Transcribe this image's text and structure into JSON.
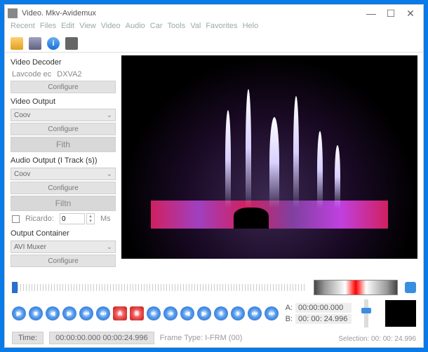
{
  "title": "Video. Mkv-Avidemux",
  "menu": [
    "Recent",
    "Files",
    "Edit",
    "View",
    "Video",
    "Audio",
    "Car",
    "Tools",
    "Val",
    "Favorites",
    "Helo"
  ],
  "side": {
    "decoder_label": "Video Decoder",
    "lavcodec": "Lavcode ec",
    "dxva": "DXVA2",
    "configure": "Configure",
    "video_output": "Video Output",
    "copy": "Coov",
    "filth": "Fith",
    "audio_output": "Audio Output (I Track (s))",
    "filtn": "Filtn",
    "ricardo": "Ricardo:",
    "ricardo_val": "0",
    "ms": "Ms",
    "container": "Output Container",
    "avi": "AVI Muxer"
  },
  "bottom": {
    "time_label": "Time:",
    "time_val": "00:00:00.000 00:00:24.996",
    "frame_type": "Frame Type: I-FRM (00)",
    "a_label": "A:",
    "a_val": "00:00:00.000",
    "b_label": "B:",
    "b_val": "00: 00: 24.996",
    "selection": "Selection: 00: 00: 24.996"
  }
}
